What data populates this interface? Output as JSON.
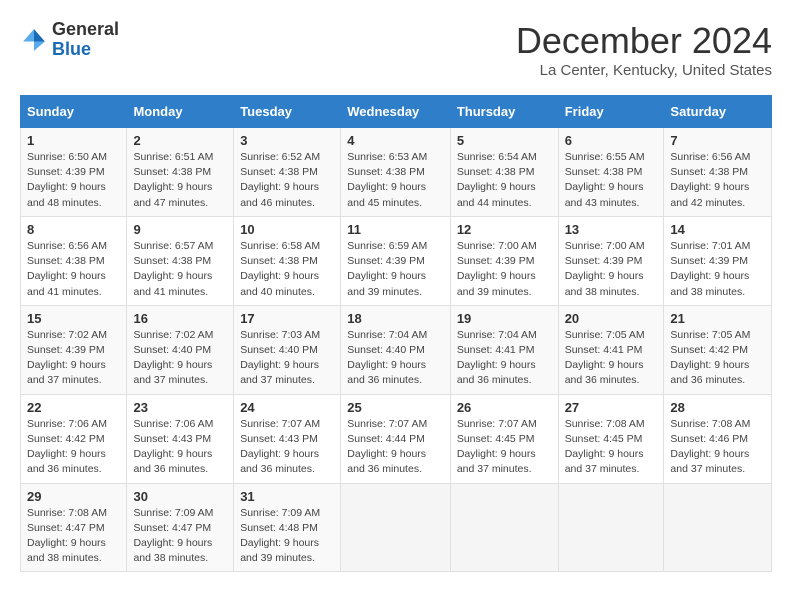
{
  "header": {
    "logo_general": "General",
    "logo_blue": "Blue",
    "title": "December 2024",
    "location": "La Center, Kentucky, United States"
  },
  "days_of_week": [
    "Sunday",
    "Monday",
    "Tuesday",
    "Wednesday",
    "Thursday",
    "Friday",
    "Saturday"
  ],
  "weeks": [
    [
      {
        "day": "1",
        "sunrise": "6:50 AM",
        "sunset": "4:39 PM",
        "daylight": "9 hours and 48 minutes."
      },
      {
        "day": "2",
        "sunrise": "6:51 AM",
        "sunset": "4:38 PM",
        "daylight": "9 hours and 47 minutes."
      },
      {
        "day": "3",
        "sunrise": "6:52 AM",
        "sunset": "4:38 PM",
        "daylight": "9 hours and 46 minutes."
      },
      {
        "day": "4",
        "sunrise": "6:53 AM",
        "sunset": "4:38 PM",
        "daylight": "9 hours and 45 minutes."
      },
      {
        "day": "5",
        "sunrise": "6:54 AM",
        "sunset": "4:38 PM",
        "daylight": "9 hours and 44 minutes."
      },
      {
        "day": "6",
        "sunrise": "6:55 AM",
        "sunset": "4:38 PM",
        "daylight": "9 hours and 43 minutes."
      },
      {
        "day": "7",
        "sunrise": "6:56 AM",
        "sunset": "4:38 PM",
        "daylight": "9 hours and 42 minutes."
      }
    ],
    [
      {
        "day": "8",
        "sunrise": "6:56 AM",
        "sunset": "4:38 PM",
        "daylight": "9 hours and 41 minutes."
      },
      {
        "day": "9",
        "sunrise": "6:57 AM",
        "sunset": "4:38 PM",
        "daylight": "9 hours and 41 minutes."
      },
      {
        "day": "10",
        "sunrise": "6:58 AM",
        "sunset": "4:38 PM",
        "daylight": "9 hours and 40 minutes."
      },
      {
        "day": "11",
        "sunrise": "6:59 AM",
        "sunset": "4:39 PM",
        "daylight": "9 hours and 39 minutes."
      },
      {
        "day": "12",
        "sunrise": "7:00 AM",
        "sunset": "4:39 PM",
        "daylight": "9 hours and 39 minutes."
      },
      {
        "day": "13",
        "sunrise": "7:00 AM",
        "sunset": "4:39 PM",
        "daylight": "9 hours and 38 minutes."
      },
      {
        "day": "14",
        "sunrise": "7:01 AM",
        "sunset": "4:39 PM",
        "daylight": "9 hours and 38 minutes."
      }
    ],
    [
      {
        "day": "15",
        "sunrise": "7:02 AM",
        "sunset": "4:39 PM",
        "daylight": "9 hours and 37 minutes."
      },
      {
        "day": "16",
        "sunrise": "7:02 AM",
        "sunset": "4:40 PM",
        "daylight": "9 hours and 37 minutes."
      },
      {
        "day": "17",
        "sunrise": "7:03 AM",
        "sunset": "4:40 PM",
        "daylight": "9 hours and 37 minutes."
      },
      {
        "day": "18",
        "sunrise": "7:04 AM",
        "sunset": "4:40 PM",
        "daylight": "9 hours and 36 minutes."
      },
      {
        "day": "19",
        "sunrise": "7:04 AM",
        "sunset": "4:41 PM",
        "daylight": "9 hours and 36 minutes."
      },
      {
        "day": "20",
        "sunrise": "7:05 AM",
        "sunset": "4:41 PM",
        "daylight": "9 hours and 36 minutes."
      },
      {
        "day": "21",
        "sunrise": "7:05 AM",
        "sunset": "4:42 PM",
        "daylight": "9 hours and 36 minutes."
      }
    ],
    [
      {
        "day": "22",
        "sunrise": "7:06 AM",
        "sunset": "4:42 PM",
        "daylight": "9 hours and 36 minutes."
      },
      {
        "day": "23",
        "sunrise": "7:06 AM",
        "sunset": "4:43 PM",
        "daylight": "9 hours and 36 minutes."
      },
      {
        "day": "24",
        "sunrise": "7:07 AM",
        "sunset": "4:43 PM",
        "daylight": "9 hours and 36 minutes."
      },
      {
        "day": "25",
        "sunrise": "7:07 AM",
        "sunset": "4:44 PM",
        "daylight": "9 hours and 36 minutes."
      },
      {
        "day": "26",
        "sunrise": "7:07 AM",
        "sunset": "4:45 PM",
        "daylight": "9 hours and 37 minutes."
      },
      {
        "day": "27",
        "sunrise": "7:08 AM",
        "sunset": "4:45 PM",
        "daylight": "9 hours and 37 minutes."
      },
      {
        "day": "28",
        "sunrise": "7:08 AM",
        "sunset": "4:46 PM",
        "daylight": "9 hours and 37 minutes."
      }
    ],
    [
      {
        "day": "29",
        "sunrise": "7:08 AM",
        "sunset": "4:47 PM",
        "daylight": "9 hours and 38 minutes."
      },
      {
        "day": "30",
        "sunrise": "7:09 AM",
        "sunset": "4:47 PM",
        "daylight": "9 hours and 38 minutes."
      },
      {
        "day": "31",
        "sunrise": "7:09 AM",
        "sunset": "4:48 PM",
        "daylight": "9 hours and 39 minutes."
      },
      null,
      null,
      null,
      null
    ]
  ]
}
